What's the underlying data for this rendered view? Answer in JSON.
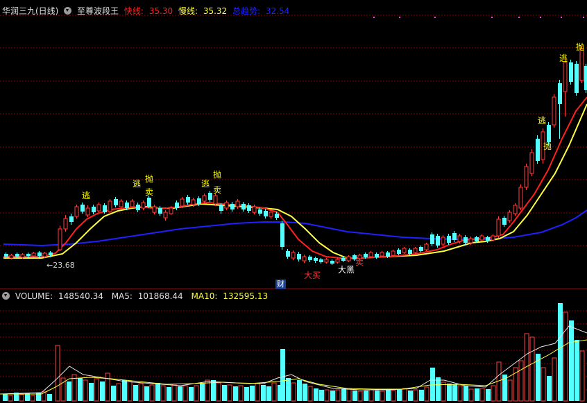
{
  "header": {
    "stock_name": "华润三九(日线)",
    "indicator_name": "至尊波段王",
    "fast_label": "快线:",
    "fast_value": "35.30",
    "slow_label": "慢线:",
    "slow_value": "35.32",
    "trend_label": "总趋势:",
    "trend_value": "32.54"
  },
  "volume_header": {
    "volume_label": "VOLUME:",
    "volume_value": "148540.34",
    "ma5_label": "MA5:",
    "ma5_value": "101868.44",
    "ma10_label": "MA10:",
    "ma10_value": "132595.13"
  },
  "annotations": {
    "low_price": "23.68",
    "finance_badge": "财"
  },
  "signals": [
    {
      "text": "逃",
      "color": "#ffff00"
    },
    {
      "text": "逃",
      "color": "#ffff00"
    },
    {
      "text": "抛",
      "color": "#ffff00"
    },
    {
      "text": "卖",
      "color": "#ffff00"
    },
    {
      "text": "逃",
      "color": "#ffff00"
    },
    {
      "text": "抛",
      "color": "#ffff00"
    },
    {
      "text": "卖",
      "color": "#ffff00"
    },
    {
      "text": "大买",
      "color": "#ff3030"
    },
    {
      "text": "大黑",
      "color": "#ffffff"
    },
    {
      "text": "卖",
      "color": "#ff3030"
    },
    {
      "text": "逃",
      "color": "#ffff00"
    },
    {
      "text": "抛",
      "color": "#ffff00"
    },
    {
      "text": "逃",
      "color": "#ffff00"
    },
    {
      "text": "抛",
      "color": "#ffff00"
    }
  ],
  "colors": {
    "up": "#ff4040",
    "down": "#54ffff",
    "fast_line": "#ff2020",
    "slow_line": "#ffff40",
    "trend_line": "#2020ff",
    "grid": "#8b0000",
    "background": "#000000"
  }
}
